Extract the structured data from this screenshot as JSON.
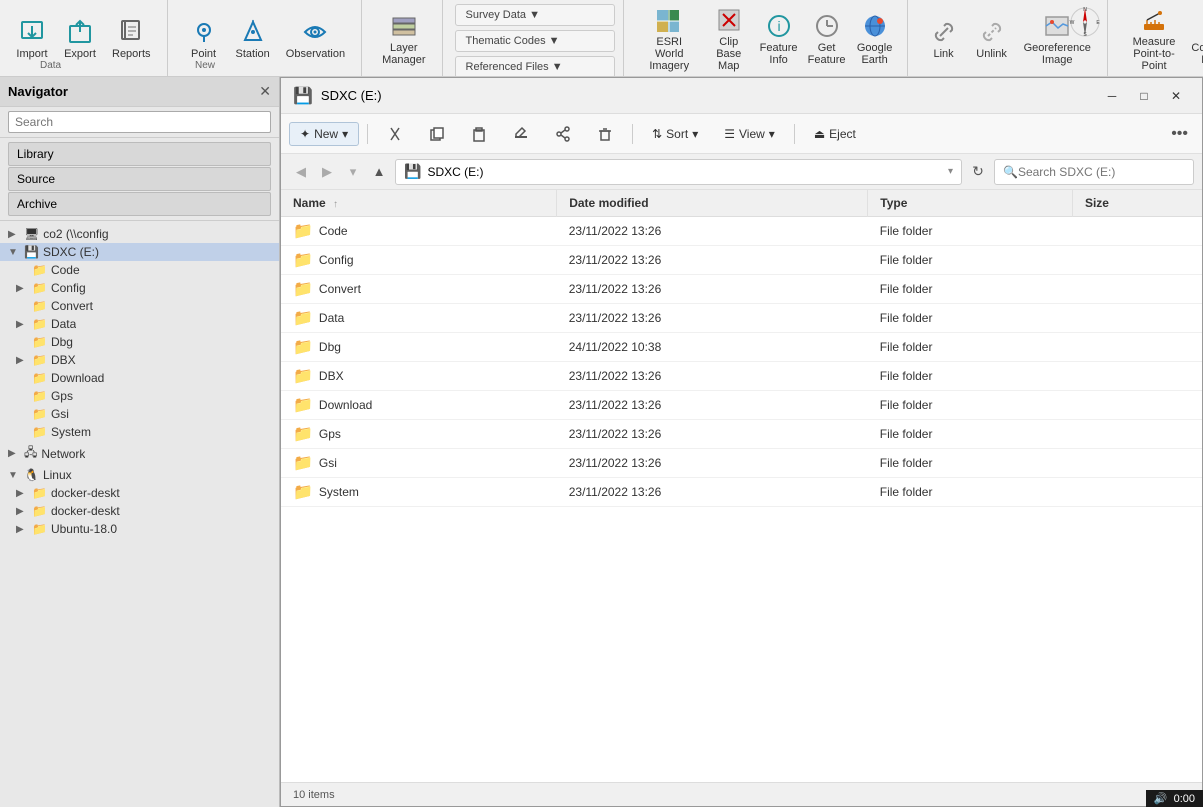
{
  "toolbar": {
    "groups": [
      {
        "name": "data",
        "label": "Data",
        "buttons": [
          {
            "id": "import",
            "label": "Import",
            "icon": "⬇"
          },
          {
            "id": "export",
            "label": "Export",
            "icon": "⬆"
          },
          {
            "id": "reports",
            "label": "Reports",
            "icon": "📋"
          }
        ]
      },
      {
        "name": "new",
        "label": "New",
        "buttons": [
          {
            "id": "point",
            "label": "Point",
            "icon": "📍"
          },
          {
            "id": "station",
            "label": "Station",
            "icon": "🔭"
          },
          {
            "id": "observation",
            "label": "Observation",
            "icon": "👁"
          }
        ]
      },
      {
        "name": "layer",
        "label": "",
        "buttons": [
          {
            "id": "layer-manager",
            "label": "Layer\nManager",
            "icon": "⊞"
          }
        ]
      },
      {
        "name": "survey",
        "label": "",
        "buttons": [
          {
            "id": "survey-data",
            "label": "Survey Data ▼",
            "icon": ""
          },
          {
            "id": "thematic-codes",
            "label": "Thematic Codes ▼",
            "icon": ""
          },
          {
            "id": "referenced-files",
            "label": "Referenced Files ▼",
            "icon": ""
          }
        ]
      },
      {
        "name": "esri",
        "label": "",
        "buttons": [
          {
            "id": "esri-world",
            "label": "ESRI\nWorld Imagery",
            "icon": "🌐"
          },
          {
            "id": "clip-base-map",
            "label": "Clip\nBase Map",
            "icon": "✂"
          },
          {
            "id": "feature-info",
            "label": "Feature\nInfo",
            "icon": "ℹ"
          },
          {
            "id": "get-feature",
            "label": "Get\nFeature",
            "icon": "🔗"
          },
          {
            "id": "google-earth",
            "label": "Google\nEarth",
            "icon": "🌍"
          }
        ]
      },
      {
        "name": "link",
        "label": "",
        "buttons": [
          {
            "id": "link",
            "label": "Link",
            "icon": "🔗"
          },
          {
            "id": "unlink",
            "label": "Unlink",
            "icon": "⛓"
          },
          {
            "id": "georeference-image",
            "label": "Georeference\nImage",
            "icon": "🗺"
          }
        ]
      },
      {
        "name": "measure",
        "label": "",
        "buttons": [
          {
            "id": "measure",
            "label": "Measure\nPoint-to-Point",
            "icon": "📏"
          },
          {
            "id": "compute-point",
            "label": "Compute\nPoint",
            "icon": "📐"
          }
        ]
      }
    ]
  },
  "navigator": {
    "title": "Navigator",
    "search_placeholder": "Search",
    "tabs": [
      "Library",
      "Source",
      "Archive"
    ],
    "tree": [
      {
        "id": "co2",
        "label": "co2 (\\\\config",
        "level": 0,
        "expanded": false,
        "type": "network"
      },
      {
        "id": "sdxc",
        "label": "SDXC (E:)",
        "level": 0,
        "expanded": true,
        "type": "drive",
        "selected": true
      },
      {
        "id": "code",
        "label": "Code",
        "level": 1,
        "expanded": false,
        "type": "folder"
      },
      {
        "id": "config",
        "label": "Config",
        "level": 1,
        "expanded": false,
        "type": "folder"
      },
      {
        "id": "convert",
        "label": "Convert",
        "level": 1,
        "expanded": false,
        "type": "folder"
      },
      {
        "id": "data",
        "label": "Data",
        "level": 1,
        "expanded": false,
        "type": "folder"
      },
      {
        "id": "dbg",
        "label": "Dbg",
        "level": 1,
        "expanded": false,
        "type": "folder"
      },
      {
        "id": "dbx",
        "label": "DBX",
        "level": 1,
        "expanded": false,
        "type": "folder"
      },
      {
        "id": "download",
        "label": "Download",
        "level": 1,
        "expanded": false,
        "type": "folder"
      },
      {
        "id": "gps",
        "label": "Gps",
        "level": 1,
        "expanded": false,
        "type": "folder"
      },
      {
        "id": "gsi",
        "label": "Gsi",
        "level": 1,
        "expanded": false,
        "type": "folder"
      },
      {
        "id": "system",
        "label": "System",
        "level": 1,
        "expanded": false,
        "type": "folder"
      },
      {
        "id": "network",
        "label": "Network",
        "level": 0,
        "expanded": false,
        "type": "network"
      },
      {
        "id": "linux",
        "label": "Linux",
        "level": 0,
        "expanded": true,
        "type": "linux"
      },
      {
        "id": "docker1",
        "label": "docker-deskt",
        "level": 1,
        "expanded": false,
        "type": "folder"
      },
      {
        "id": "docker2",
        "label": "docker-deskt",
        "level": 1,
        "expanded": false,
        "type": "folder"
      },
      {
        "id": "ubuntu",
        "label": "Ubuntu-18.0",
        "level": 1,
        "expanded": false,
        "type": "folder"
      }
    ]
  },
  "window": {
    "title": "SDXC (E:)",
    "address": "SDXC (E:)",
    "search_placeholder": "Search SDXC (E:)",
    "toolbar_buttons": {
      "new": "✦ New ▾",
      "cut": "✂",
      "copy": "⎘",
      "paste": "📋",
      "rename": "✏",
      "share": "⤴",
      "delete": "🗑",
      "sort": "⇅ Sort ▾",
      "view": "☰ View ▾",
      "eject": "⏏ Eject",
      "more": "•••"
    },
    "columns": [
      "Name",
      "Date modified",
      "Type",
      "Size"
    ],
    "files": [
      {
        "name": "Code",
        "date": "23/11/2022 13:26",
        "type": "File folder",
        "size": ""
      },
      {
        "name": "Config",
        "date": "23/11/2022 13:26",
        "type": "File folder",
        "size": ""
      },
      {
        "name": "Convert",
        "date": "23/11/2022 13:26",
        "type": "File folder",
        "size": ""
      },
      {
        "name": "Data",
        "date": "23/11/2022 13:26",
        "type": "File folder",
        "size": ""
      },
      {
        "name": "Dbg",
        "date": "24/11/2022 10:38",
        "type": "File folder",
        "size": ""
      },
      {
        "name": "DBX",
        "date": "23/11/2022 13:26",
        "type": "File folder",
        "size": ""
      },
      {
        "name": "Download",
        "date": "23/11/2022 13:26",
        "type": "File folder",
        "size": ""
      },
      {
        "name": "Gps",
        "date": "23/11/2022 13:26",
        "type": "File folder",
        "size": ""
      },
      {
        "name": "Gsi",
        "date": "23/11/2022 13:26",
        "type": "File folder",
        "size": ""
      },
      {
        "name": "System",
        "date": "23/11/2022 13:26",
        "type": "File folder",
        "size": ""
      }
    ],
    "status": "10 items"
  },
  "clock": {
    "time": "0:00",
    "icon": "🔊"
  }
}
